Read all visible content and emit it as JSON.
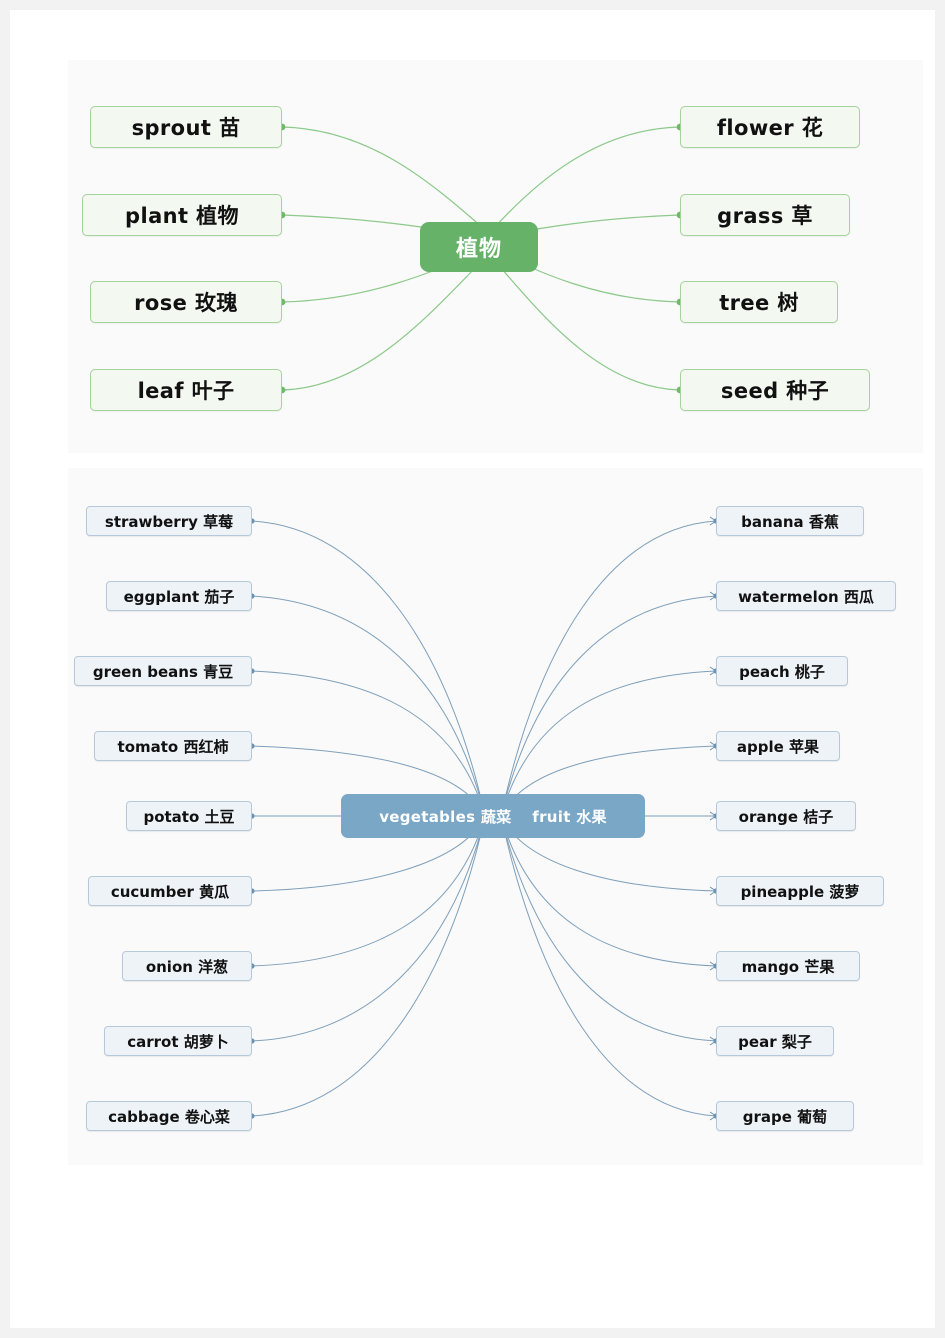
{
  "theme": {
    "page_background": "#f2f2f2",
    "document_background": "#ffffff",
    "panel_background": "#fafafa",
    "green_accent": "#66b268",
    "green_node_fill": "#f3f8f1",
    "green_node_border": "#a5d39c",
    "blue_accent": "#7ba7c7",
    "blue_node_fill": "#eef3f8",
    "blue_node_border": "#b6c9db"
  },
  "maps": [
    {
      "id": "plants",
      "center": {
        "label": "植物"
      },
      "left_nodes": [
        {
          "label": "sprout  苗"
        },
        {
          "label": "plant  植物"
        },
        {
          "label": "rose  玫瑰"
        },
        {
          "label": "leaf  叶子"
        }
      ],
      "right_nodes": [
        {
          "label": "flower 花"
        },
        {
          "label": "grass  草"
        },
        {
          "label": "tree   树"
        },
        {
          "label": "seed  种子"
        }
      ]
    },
    {
      "id": "produce",
      "center": {
        "label": "vegetables 蔬菜　 fruit  水果"
      },
      "left_nodes": [
        {
          "label": "strawberry 草莓"
        },
        {
          "label": "eggplant 茄子"
        },
        {
          "label": "green beans 青豆"
        },
        {
          "label": "tomato 西红柿"
        },
        {
          "label": "potato 土豆"
        },
        {
          "label": "cucumber 黄瓜"
        },
        {
          "label": "onion 洋葱"
        },
        {
          "label": "carrot 胡萝卜"
        },
        {
          "label": "cabbage 卷心菜"
        }
      ],
      "right_nodes": [
        {
          "label": "banana  香蕉"
        },
        {
          "label": "watermelon  西瓜"
        },
        {
          "label": "peach  桃子"
        },
        {
          "label": "apple  苹果"
        },
        {
          "label": "orange  桔子"
        },
        {
          "label": "pineapple  菠萝"
        },
        {
          "label": "mango  芒果"
        },
        {
          "label": "pear  梨子"
        },
        {
          "label": "grape  葡萄"
        }
      ]
    }
  ]
}
